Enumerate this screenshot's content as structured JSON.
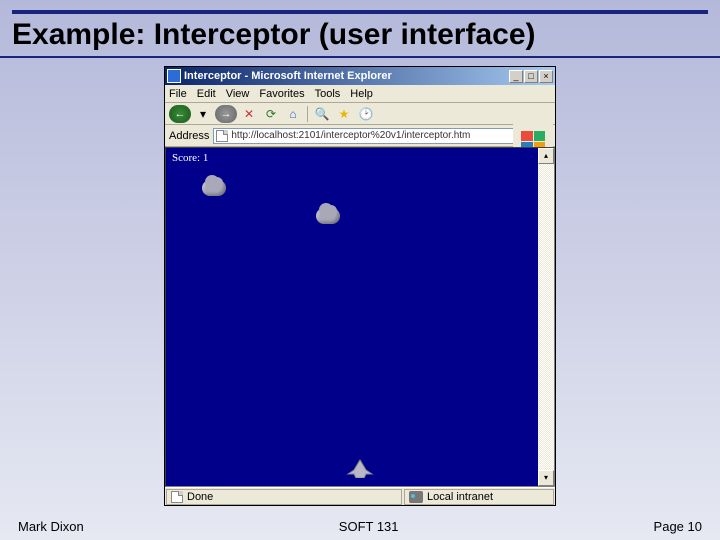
{
  "slide": {
    "title": "Example: Interceptor (user interface)"
  },
  "window": {
    "title": "Interceptor - Microsoft Internet Explorer"
  },
  "menu": {
    "file": "File",
    "edit": "Edit",
    "view": "View",
    "favorites": "Favorites",
    "tools": "Tools",
    "help": "Help"
  },
  "address": {
    "label": "Address",
    "value": "http://localhost:2101/interceptor%20v1/interceptor.htm"
  },
  "game": {
    "scoreLabel": "Score: 1"
  },
  "status": {
    "done": "Done",
    "zone": "Local intranet"
  },
  "footer": {
    "author": "Mark Dixon",
    "course": "SOFT 131",
    "page": "Page 10"
  }
}
